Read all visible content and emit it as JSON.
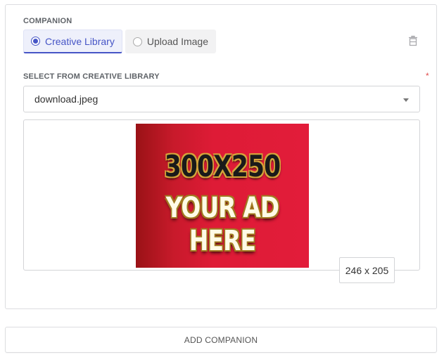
{
  "companion": {
    "section_label": "COMPANION",
    "source_options": [
      {
        "label": "Creative Library",
        "selected": true
      },
      {
        "label": "Upload Image",
        "selected": false
      }
    ],
    "delete_icon": "trash-icon"
  },
  "creative_select": {
    "label": "SELECT FROM CREATIVE LIBRARY",
    "required_marker": "*",
    "value": "download.jpeg"
  },
  "preview": {
    "ad_lines": [
      "300X250",
      "YOUR AD",
      "HERE"
    ],
    "dimensions": "246 x 205"
  },
  "footer": {
    "add_label": "ADD COMPANION"
  },
  "colors": {
    "accent": "#4655c6",
    "required": "#e04a4a",
    "ad_background": "#e21c3a"
  }
}
